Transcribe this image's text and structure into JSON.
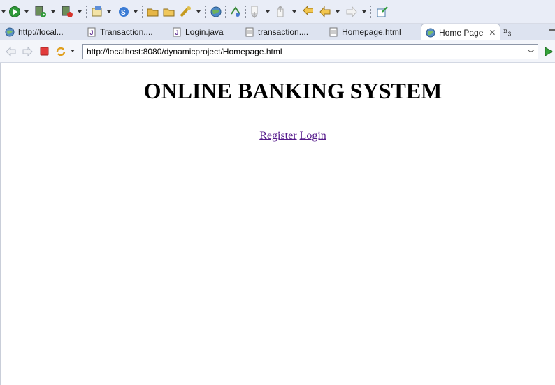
{
  "tabs": [
    {
      "label": "http://local...",
      "icon": "globe-icon"
    },
    {
      "label": "Transaction....",
      "icon": "java-file-icon"
    },
    {
      "label": "Login.java",
      "icon": "java-file-icon"
    },
    {
      "label": "transaction....",
      "icon": "text-file-icon"
    },
    {
      "label": "Homepage.html",
      "icon": "text-file-icon"
    },
    {
      "label": "Home Page",
      "icon": "globe-icon",
      "active": true
    }
  ],
  "tab_overflow": {
    "symbol": "»",
    "count": "3"
  },
  "address_bar": {
    "url": "http://localhost:8080/dynamicproject/Homepage.html"
  },
  "page": {
    "heading": "ONLINE BANKING SYSTEM",
    "links": {
      "register": "Register",
      "login": "Login"
    }
  },
  "colors": {
    "link_visited": "#551a8b",
    "toolbar_bg": "#e9edf7"
  }
}
